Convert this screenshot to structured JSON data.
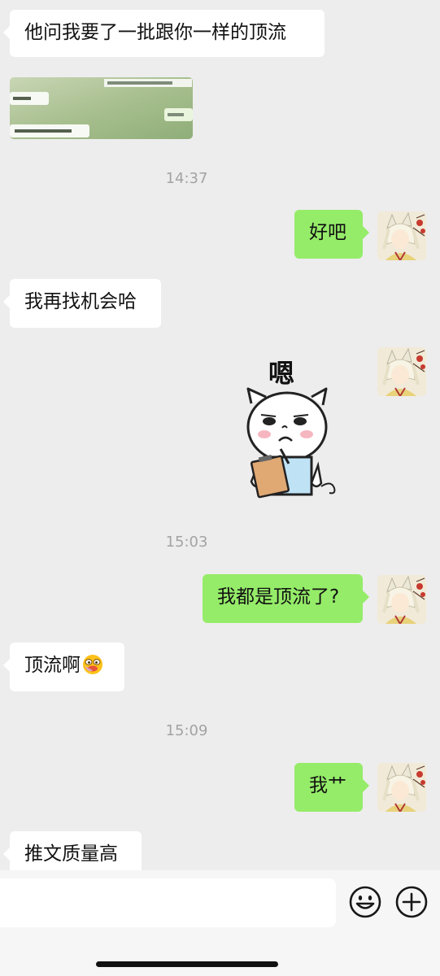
{
  "chat": {
    "messages": [
      {
        "side": "in",
        "text": "他问我要了一批跟你一样的顶流"
      },
      {
        "side": "in",
        "type": "image"
      },
      {
        "type": "time",
        "text": "14:37"
      },
      {
        "side": "out",
        "text": "好吧"
      },
      {
        "side": "in",
        "text": "我再找机会哈"
      },
      {
        "side": "out",
        "type": "sticker",
        "caption": "嗯"
      },
      {
        "type": "time",
        "text": "15:03"
      },
      {
        "side": "out",
        "text": "我都是顶流了?"
      },
      {
        "side": "in",
        "text": "顶流啊",
        "emoji": "drooling-face-emoji"
      },
      {
        "type": "time",
        "text": "15:09"
      },
      {
        "side": "out",
        "text": "我艹"
      },
      {
        "side": "in",
        "text": "推文质量高"
      }
    ]
  },
  "input_bar": {
    "value": "",
    "icons": [
      "smiley-face-icon",
      "plus-circle-icon"
    ]
  },
  "colors": {
    "background": "#ededed",
    "incoming_bubble": "#ffffff",
    "outgoing_bubble": "#95ec69",
    "timestamp": "#a3a3a3"
  }
}
